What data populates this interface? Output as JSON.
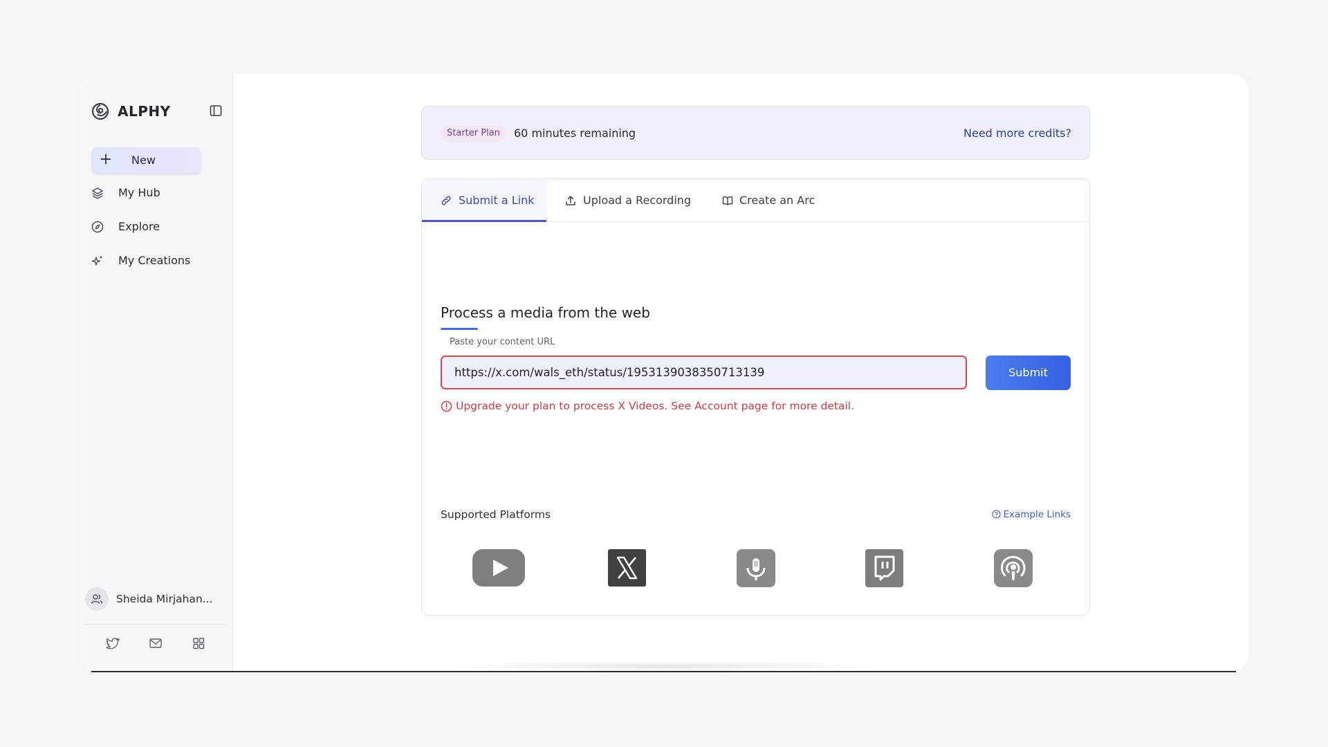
{
  "app": {
    "name": "ALPHY"
  },
  "sidebar": {
    "new_label": "New",
    "items": [
      {
        "label": "My Hub",
        "icon": "layers-icon"
      },
      {
        "label": "Explore",
        "icon": "compass-icon"
      },
      {
        "label": "My Creations",
        "icon": "sparkles-icon"
      }
    ],
    "user": {
      "name": "Sheida Mirjahan..."
    },
    "footer_icons": [
      "twitter-icon",
      "mail-icon",
      "grid-icon"
    ]
  },
  "banner": {
    "plan": "Starter Plan",
    "remaining": "60 minutes remaining",
    "more_credits": "Need more credits?"
  },
  "tabs": [
    {
      "label": "Submit a Link",
      "icon": "link-icon",
      "active": true
    },
    {
      "label": "Upload a Recording",
      "icon": "upload-icon",
      "active": false
    },
    {
      "label": "Create an Arc",
      "icon": "book-icon",
      "active": false
    }
  ],
  "form": {
    "heading": "Process a media from the web",
    "field_label": "Paste your content URL",
    "url_value": "https://x.com/wals_eth/status/1953139038350713139",
    "submit_label": "Submit",
    "error": "Upgrade your plan to process X Videos. See Account page for more detail."
  },
  "platforms": {
    "title": "Supported Platforms",
    "example_links": "Example Links",
    "items": [
      "youtube-icon",
      "x-icon",
      "podcast-mic-icon",
      "twitch-icon",
      "apple-podcasts-icon"
    ]
  },
  "colors": {
    "accent": "#3f6fe8",
    "error": "#d8393f",
    "banner_bg": "#eff0fc",
    "tab_active": "#3a47b8"
  }
}
